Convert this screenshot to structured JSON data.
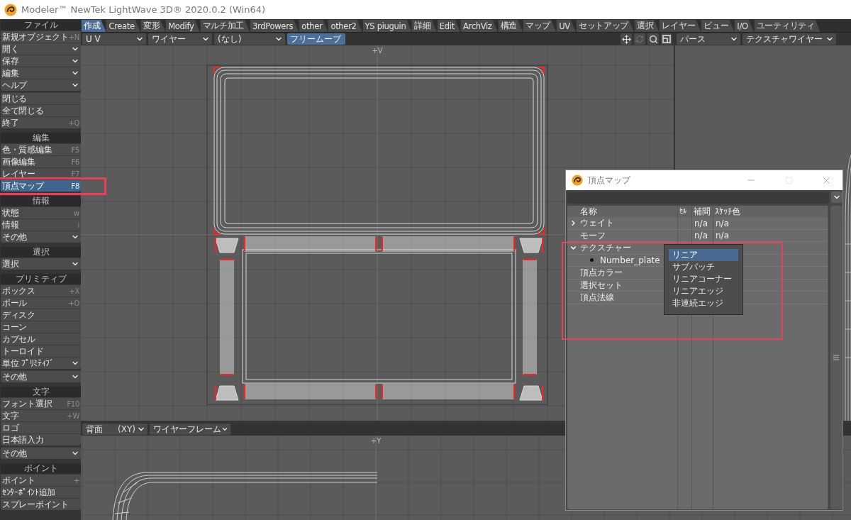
{
  "window": {
    "title": "Modeler™ NewTek LightWave 3D® 2020.0.2 (Win64)"
  },
  "sidebar": {
    "groups": [
      {
        "header": "ファイル",
        "items": [
          {
            "kind": "command",
            "label": "新規オブジェクト",
            "shortcut": "+N",
            "selected": false
          },
          {
            "kind": "menu",
            "label": "開く",
            "selected": false
          },
          {
            "kind": "menu",
            "label": "保存",
            "selected": false
          },
          {
            "kind": "menu",
            "label": "編集",
            "selected": false
          },
          {
            "kind": "menu",
            "label": "ヘルプ",
            "selected": false
          }
        ]
      },
      {
        "items": [
          {
            "kind": "command",
            "label": "閉じる",
            "selected": false
          },
          {
            "kind": "command",
            "label": "全て閉じる",
            "selected": false
          },
          {
            "kind": "command",
            "label": "終了",
            "shortcut": "+Q",
            "selected": false
          }
        ]
      },
      {
        "header": "編集",
        "items": [
          {
            "kind": "command",
            "label": "色・質感編集",
            "shortcut": "F5",
            "selected": false
          },
          {
            "kind": "command",
            "label": "画像編集",
            "shortcut": "F6",
            "selected": false
          },
          {
            "kind": "command",
            "label": "レイヤー",
            "shortcut": "F7",
            "selected": false
          },
          {
            "kind": "command",
            "label": "頂点マップ",
            "shortcut": "F8",
            "selected": true
          }
        ]
      },
      {
        "header": "情報",
        "items": [
          {
            "kind": "command",
            "label": "状態",
            "shortcut": "w",
            "selected": false
          },
          {
            "kind": "command",
            "label": "情報",
            "shortcut": "i",
            "selected": false
          },
          {
            "kind": "menu",
            "label": "その他",
            "selected": false
          }
        ]
      },
      {
        "header": "選択",
        "items": [
          {
            "kind": "menu",
            "label": "選択",
            "selected": false
          }
        ]
      },
      {
        "header": "プリミティブ",
        "items": [
          {
            "kind": "command",
            "label": "ボックス",
            "shortcut": "+X",
            "selected": false
          },
          {
            "kind": "command",
            "label": "ボール",
            "shortcut": "+O",
            "selected": false
          },
          {
            "kind": "command",
            "label": "ディスク",
            "selected": false
          },
          {
            "kind": "command",
            "label": "コーン",
            "selected": false
          },
          {
            "kind": "command",
            "label": "カプセル",
            "selected": false
          },
          {
            "kind": "command",
            "label": "トーロイド",
            "selected": false
          },
          {
            "kind": "menu",
            "label": "単位 ﾌﾟﾘﾐﾃｨﾌﾞ",
            "selected": false
          }
        ]
      },
      {
        "items": [
          {
            "kind": "menu",
            "label": "その他",
            "selected": false
          }
        ]
      },
      {
        "header": "文字",
        "items": [
          {
            "kind": "command",
            "label": "フォント選択",
            "shortcut": "F10",
            "selected": false
          },
          {
            "kind": "command",
            "label": "文字",
            "shortcut": "+W",
            "selected": false
          },
          {
            "kind": "command",
            "label": "ロゴ",
            "selected": false
          },
          {
            "kind": "command",
            "label": "日本語入力",
            "selected": false
          }
        ]
      },
      {
        "items": [
          {
            "kind": "menu",
            "label": "その他",
            "selected": false
          }
        ]
      },
      {
        "header": "ポイント",
        "items": [
          {
            "kind": "command",
            "label": "ポイント",
            "shortcut": "+",
            "selected": false
          },
          {
            "kind": "command",
            "label": "ｾﾝﾀｰﾎﾟｲﾝﾄ追加",
            "selected": false
          },
          {
            "kind": "command",
            "label": "スプレーポイント",
            "selected": false
          }
        ]
      }
    ]
  },
  "tabs": [
    {
      "label": "作成",
      "selected": true
    },
    {
      "label": "Create",
      "selected": false
    },
    {
      "label": "変形",
      "selected": false
    },
    {
      "label": "Modify",
      "selected": false
    },
    {
      "label": "マルチ加工",
      "selected": false
    },
    {
      "label": "3rdPowers",
      "selected": false
    },
    {
      "label": "other",
      "selected": false
    },
    {
      "label": "other2",
      "selected": false
    },
    {
      "label": "YS piuguin",
      "selected": false
    },
    {
      "label": "詳細",
      "selected": false
    },
    {
      "label": "Edit",
      "selected": false
    },
    {
      "label": "ArchViz",
      "selected": false
    },
    {
      "label": "構造",
      "selected": false
    },
    {
      "label": "マップ",
      "selected": false
    },
    {
      "label": "UV",
      "selected": false
    },
    {
      "label": "セットアップ",
      "selected": false
    },
    {
      "label": "選択",
      "selected": false
    },
    {
      "label": "レイヤー",
      "selected": false
    },
    {
      "label": "ビュー",
      "selected": false
    },
    {
      "label": "I/O",
      "selected": false
    },
    {
      "label": "ユーティリティ",
      "selected": false
    }
  ],
  "uv_view": {
    "toolbar": [
      {
        "kind": "dropdown",
        "value": "U V"
      },
      {
        "kind": "dropdown",
        "value": "ワイヤー"
      },
      {
        "kind": "dropdown",
        "value": "(なし)"
      },
      {
        "kind": "toggle",
        "label": "フリームーブ",
        "on": true
      }
    ],
    "axis_label": "+V"
  },
  "perspective_view": {
    "toolbar": [
      {
        "kind": "dropdown",
        "value": "パース"
      },
      {
        "kind": "dropdown",
        "value": "テクスチャワイヤー"
      }
    ]
  },
  "back_view": {
    "toolbar": [
      {
        "kind": "dropdown",
        "value": "背面",
        "suffix": "(XY)"
      },
      {
        "kind": "dropdown",
        "value": "ワイヤーフレーム"
      }
    ],
    "axis_label": "+Y"
  },
  "dialog": {
    "title": "頂点マップ",
    "columns": [
      "名称",
      "ｾﾙ",
      "補間",
      "ｽｹｯﾁ色"
    ],
    "rows": [
      {
        "name": "ウェイト",
        "expanded": false,
        "interpolation": "n/a",
        "sketch_color": "n/a"
      },
      {
        "name": "モーフ",
        "interpolation": "n/a",
        "sketch_color": "n/a"
      },
      {
        "name": "テクスチャー",
        "expanded": true,
        "children": [
          {
            "name": "Number_plate"
          }
        ]
      },
      {
        "name": "頂点カラー"
      },
      {
        "name": "選択セット"
      },
      {
        "name": "頂点法線"
      }
    ],
    "menu": {
      "items": [
        {
          "label": "リニア",
          "selected": true
        },
        {
          "label": "サブパッチ",
          "selected": false
        },
        {
          "label": "リニアコーナー",
          "selected": false
        },
        {
          "label": "リニアエッジ",
          "selected": false
        },
        {
          "label": "非連続エッジ",
          "selected": false
        }
      ]
    }
  }
}
